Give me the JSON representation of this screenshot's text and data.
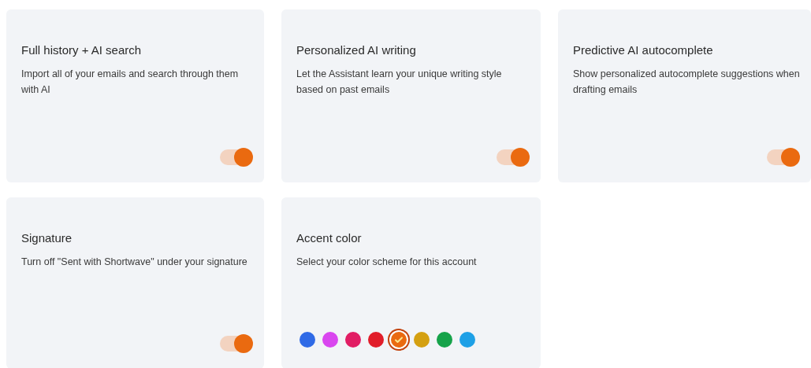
{
  "cards": [
    {
      "kind": "toggle",
      "title": "Full history + AI search",
      "description": "Import all of your emails and search through them with AI",
      "on": true
    },
    {
      "kind": "toggle",
      "title": "Personalized AI writing",
      "description": "Let the Assistant learn your unique writing style based on past emails",
      "on": true
    },
    {
      "kind": "toggle",
      "title": "Predictive AI autocomplete",
      "description": "Show personalized autocomplete suggestions when drafting emails",
      "on": true
    },
    {
      "kind": "toggle",
      "title": "Signature",
      "description": "Turn off \"Sent with Shortwave\" under your signature",
      "on": true
    },
    {
      "kind": "colors",
      "title": "Accent color",
      "description": "Select your color scheme for this account",
      "swatches": [
        {
          "color": "#2f6ae6",
          "selected": false
        },
        {
          "color": "#d946ef",
          "selected": false
        },
        {
          "color": "#e11d64",
          "selected": false
        },
        {
          "color": "#e11d2a",
          "selected": false
        },
        {
          "color": "#ea6a10",
          "selected": true
        },
        {
          "color": "#d4a012",
          "selected": false
        },
        {
          "color": "#16a34a",
          "selected": false
        },
        {
          "color": "#1ea0e6",
          "selected": false
        }
      ]
    }
  ]
}
